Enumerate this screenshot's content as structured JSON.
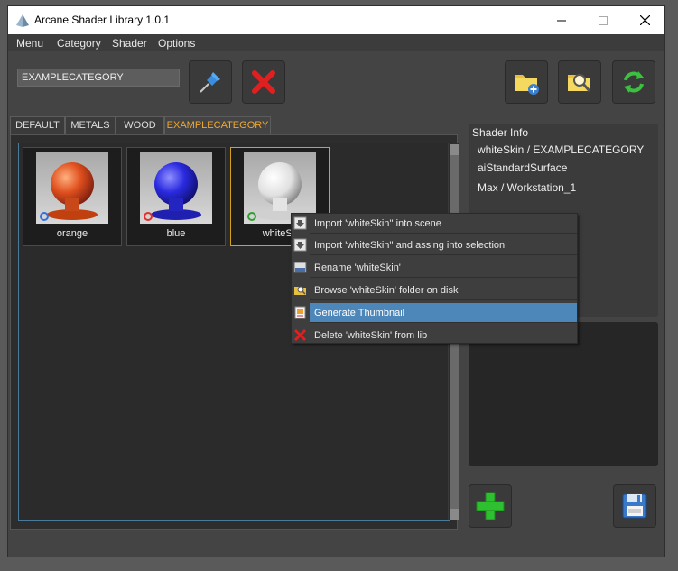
{
  "window": {
    "title": "Arcane Shader Library 1.0.1"
  },
  "menubar": [
    "Menu",
    "Category",
    "Shader",
    "Options"
  ],
  "toolbar": {
    "category_value": "EXAMPLECATEGORY"
  },
  "tabs": [
    "DEFAULT",
    "METALS",
    "WOOD",
    "EXAMPLECATEGORY"
  ],
  "active_tab": "EXAMPLECATEGORY",
  "shaders": [
    {
      "name": "orange",
      "color": "#e0501e"
    },
    {
      "name": "blue",
      "color": "#2a2ae0"
    },
    {
      "name": "whiteSkin",
      "color": "#e8e8e8"
    }
  ],
  "thumb_labels": {
    "orange": "orange",
    "blue": "blue",
    "white": "whiteSk"
  },
  "info": {
    "title": "Shader Info",
    "line1": "whiteSkin / EXAMPLECATEGORY",
    "line2": "aiStandardSurface",
    "line3": "Max / Workstation_1"
  },
  "context_menu": {
    "items": [
      "Import 'whiteSkin'' into scene",
      "Import 'whiteSkin'' and assing into selection",
      "Rename 'whiteSkin'",
      "Browse 'whiteSkin' folder on disk",
      "Generate Thumbnail",
      "Delete 'whiteSkin' from lib"
    ],
    "highlighted": "Generate Thumbnail"
  },
  "colors": {
    "accent": "#f0a830",
    "highlight": "#4d86b8",
    "selection": "#d4a020"
  }
}
